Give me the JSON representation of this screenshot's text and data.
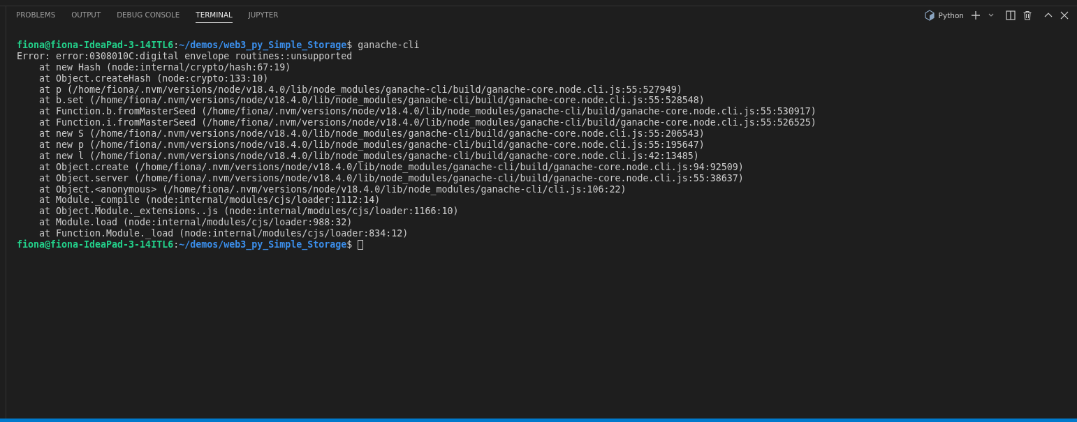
{
  "tabs": [
    {
      "label": "PROBLEMS",
      "selected": false
    },
    {
      "label": "OUTPUT",
      "selected": false
    },
    {
      "label": "DEBUG CONSOLE",
      "selected": false
    },
    {
      "label": "TERMINAL",
      "selected": true
    },
    {
      "label": "JUPYTER",
      "selected": false
    }
  ],
  "terminal_profile": {
    "label": "Python"
  },
  "lines": [
    {
      "kind": "prompt",
      "user": "fiona@fiona-IdeaPad-3-14ITL6",
      "separator": ":",
      "path": "~/demos/web3_py_Simple_Storage",
      "sign": "$",
      "command": "ganache-cli",
      "cursor": false
    },
    {
      "kind": "output",
      "text": "Error: error:0308010C:digital envelope routines::unsupported"
    },
    {
      "kind": "output",
      "text": "    at new Hash (node:internal/crypto/hash:67:19)"
    },
    {
      "kind": "output",
      "text": "    at Object.createHash (node:crypto:133:10)"
    },
    {
      "kind": "output",
      "text": "    at p (/home/fiona/.nvm/versions/node/v18.4.0/lib/node_modules/ganache-cli/build/ganache-core.node.cli.js:55:527949)"
    },
    {
      "kind": "output",
      "text": "    at b.set (/home/fiona/.nvm/versions/node/v18.4.0/lib/node_modules/ganache-cli/build/ganache-core.node.cli.js:55:528548)"
    },
    {
      "kind": "output",
      "text": "    at Function.b.fromMasterSeed (/home/fiona/.nvm/versions/node/v18.4.0/lib/node_modules/ganache-cli/build/ganache-core.node.cli.js:55:530917)"
    },
    {
      "kind": "output",
      "text": "    at Function.i.fromMasterSeed (/home/fiona/.nvm/versions/node/v18.4.0/lib/node_modules/ganache-cli/build/ganache-core.node.cli.js:55:526525)"
    },
    {
      "kind": "output",
      "text": "    at new S (/home/fiona/.nvm/versions/node/v18.4.0/lib/node_modules/ganache-cli/build/ganache-core.node.cli.js:55:206543)"
    },
    {
      "kind": "output",
      "text": "    at new p (/home/fiona/.nvm/versions/node/v18.4.0/lib/node_modules/ganache-cli/build/ganache-core.node.cli.js:55:195647)"
    },
    {
      "kind": "output",
      "text": "    at new l (/home/fiona/.nvm/versions/node/v18.4.0/lib/node_modules/ganache-cli/build/ganache-core.node.cli.js:42:13485)"
    },
    {
      "kind": "output",
      "text": "    at Object.create (/home/fiona/.nvm/versions/node/v18.4.0/lib/node_modules/ganache-cli/build/ganache-core.node.cli.js:94:92509)"
    },
    {
      "kind": "output",
      "text": "    at Object.server (/home/fiona/.nvm/versions/node/v18.4.0/lib/node_modules/ganache-cli/build/ganache-core.node.cli.js:55:38637)"
    },
    {
      "kind": "output",
      "text": "    at Object.<anonymous> (/home/fiona/.nvm/versions/node/v18.4.0/lib/node_modules/ganache-cli/cli.js:106:22)"
    },
    {
      "kind": "output",
      "text": "    at Module._compile (node:internal/modules/cjs/loader:1112:14)"
    },
    {
      "kind": "output",
      "text": "    at Object.Module._extensions..js (node:internal/modules/cjs/loader:1166:10)"
    },
    {
      "kind": "output",
      "text": "    at Module.load (node:internal/modules/cjs/loader:988:32)"
    },
    {
      "kind": "output",
      "text": "    at Function.Module._load (node:internal/modules/cjs/loader:834:12)"
    },
    {
      "kind": "prompt",
      "user": "fiona@fiona-IdeaPad-3-14ITL6",
      "separator": ":",
      "path": "~/demos/web3_py_Simple_Storage",
      "sign": "$",
      "cursor": true
    }
  ]
}
